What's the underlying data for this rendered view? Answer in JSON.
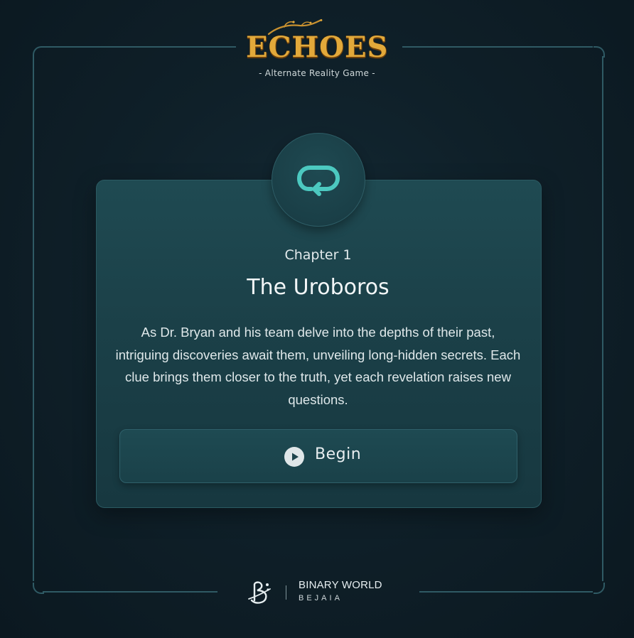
{
  "brand": {
    "logo_text": "ECHOES",
    "subtitle": "- Alternate Reality Game -"
  },
  "chapter": {
    "icon": "loop-arrow-icon",
    "label": "Chapter 1",
    "title": "The Uroboros",
    "description": "As Dr. Bryan and his team delve into the depths of their past, intriguing discoveries await them, unveiling long-hidden secrets. Each clue brings them closer to the truth, yet each revelation raises new questions."
  },
  "actions": {
    "begin_label": "Begin",
    "begin_icon": "play-icon"
  },
  "footer": {
    "logo_icon": "binary-world-logo-icon",
    "name": "BINARY WORLD",
    "city": "BEJAIA"
  },
  "colors": {
    "accent": "#4cc9c0",
    "logo_gold": "#e2a93a",
    "frame": "#2f5a64",
    "card": "#1f4a52",
    "background": "#0f2029"
  }
}
